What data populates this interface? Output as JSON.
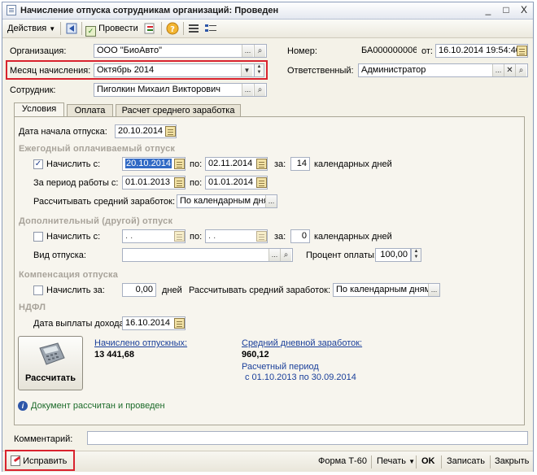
{
  "window": {
    "title": "Начисление отпуска сотрудникам организаций: Проведен",
    "controls": [
      "_",
      "□",
      "X"
    ]
  },
  "toolbar": {
    "actions_label": "Действия",
    "post_label": "Провести"
  },
  "header": {
    "organization_label": "Организация:",
    "organization_value": "ООО \"БиоАвто\"",
    "number_label": "Номер:",
    "number_value": "БА000000006",
    "from_label": "от:",
    "date_value": "16.10.2014 19:54:40",
    "month_label": "Месяц начисления:",
    "month_value": "Октябрь 2014",
    "responsible_label": "Ответственный:",
    "responsible_value": "Администратор",
    "employee_label": "Сотрудник:",
    "employee_value": "Пиголкин Михаил Викторович"
  },
  "tabs": [
    {
      "label": "Условия",
      "active": true
    },
    {
      "label": "Оплата",
      "active": false
    },
    {
      "label": "Расчет среднего заработка",
      "active": false
    }
  ],
  "conditions": {
    "start_date_label": "Дата начала отпуска:",
    "start_date_value": "20.10.2014",
    "annual": {
      "section_title": "Ежегодный оплачиваемый отпуск",
      "accrue_label": "Начислить с:",
      "accrue_checked": true,
      "from_value": "20.10.2014",
      "to_label": "по:",
      "to_value": "02.11.2014",
      "days_label": "за:",
      "days_value": "14",
      "days_suffix": "календарных дней",
      "period_label": "За период работы с:",
      "period_from": "01.01.2013",
      "period_to_label": "по:",
      "period_to": "01.01.2014",
      "avg_label": "Рассчитывать средний заработок:",
      "avg_value": "По календарным дня"
    },
    "additional": {
      "section_title": "Дополнительный (другой) отпуск",
      "accrue_label": "Начислить с:",
      "accrue_checked": false,
      "from_value": " . .",
      "to_label": "по:",
      "to_value": " . .",
      "days_label": "за:",
      "days_value": "0",
      "days_suffix": "календарных дней",
      "kind_label": "Вид отпуска:",
      "kind_value": "",
      "percent_label": "Процент оплаты:",
      "percent_value": "100,00"
    },
    "compensation": {
      "section_title": "Компенсация отпуска",
      "accrue_label": "Начислить за:",
      "accrue_checked": false,
      "days_value": "0,00",
      "days_suffix": "дней",
      "avg_label": "Рассчитывать средний заработок:",
      "avg_value": "По календарным дням"
    },
    "ndfl": {
      "section_title": "НДФЛ",
      "payout_label": "Дата выплаты дохода:",
      "payout_value": "16.10.2014"
    },
    "calc_button_label": "Рассчитать",
    "accrued_label": "Начислено отпускных:",
    "accrued_value": "13 441,68",
    "avg_daily_label": "Средний дневной заработок:",
    "avg_daily_value": "960,12",
    "period_caption": "Расчетный период",
    "period_range": "с 01.10.2013 по 30.09.2014"
  },
  "status": {
    "text": "Документ рассчитан и проведен"
  },
  "comment": {
    "label": "Комментарий:",
    "value": ""
  },
  "footer": {
    "fix_label": "Исправить",
    "form_label": "Форма Т-60",
    "print_label": "Печать",
    "ok_label": "OK",
    "save_label": "Записать",
    "close_label": "Закрыть"
  },
  "colors": {
    "highlight_border": "#d9232e",
    "link": "#1a3f9a",
    "section_gray": "#a8a39a"
  }
}
